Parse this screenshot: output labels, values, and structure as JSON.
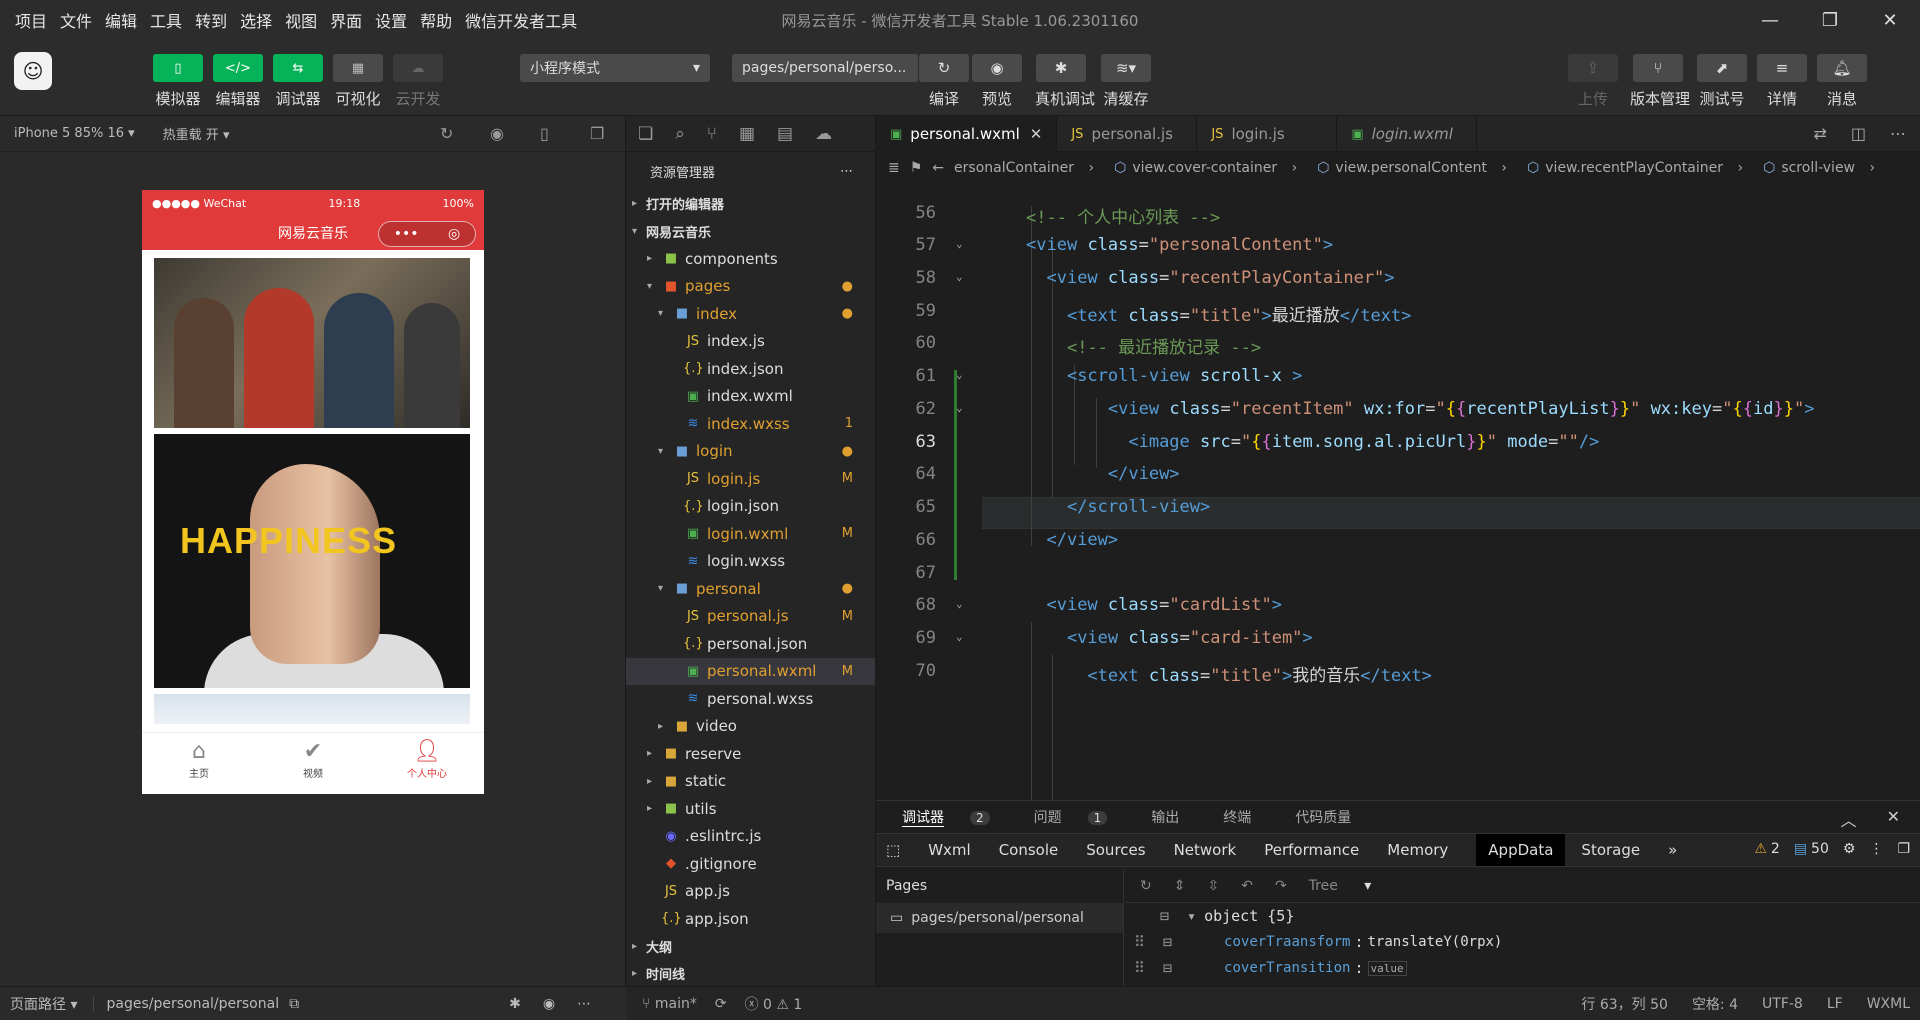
{
  "menubar": {
    "items": [
      "项目",
      "文件",
      "编辑",
      "工具",
      "转到",
      "选择",
      "视图",
      "界面",
      "设置",
      "帮助",
      "微信开发者工具"
    ],
    "title": "网易云音乐 - 微信开发者工具 Stable 1.06.2301160"
  },
  "toolbar": {
    "simulator": "模拟器",
    "editor": "编辑器",
    "debugger": "调试器",
    "visual": "可视化",
    "cloud": "云开发",
    "mode_select": "小程序模式",
    "page_select": "pages/personal/perso...",
    "compile": "编译",
    "preview": "预览",
    "real_debug": "真机调试",
    "clear_cache": "清缓存",
    "upload": "上传",
    "version": "版本管理",
    "test": "测试号",
    "details": "详情",
    "messages": "消息"
  },
  "simulator": {
    "device": "iPhone 5 85% 16",
    "hot_reload": "热重载 开",
    "phone": {
      "carrier": "●●●●● WeChat",
      "time": "19:18",
      "battery": "100%",
      "nav_title": "网易云音乐",
      "poster_text": "HAPPINESS",
      "tabs": [
        "主页",
        "视频",
        "个人中心"
      ]
    },
    "page_path_label": "页面路径",
    "page_path": "pages/personal/personal"
  },
  "explorer": {
    "title": "资源管理器",
    "open_editors": "打开的编辑器",
    "project": "网易云音乐",
    "outline": "大纲",
    "timeline": "时间线",
    "items": [
      {
        "name": "components",
        "depth": 1,
        "type": "folder",
        "status": ""
      },
      {
        "name": "pages",
        "depth": 1,
        "type": "folder-open",
        "status": "●",
        "color": "#e0a030"
      },
      {
        "name": "index",
        "depth": 2,
        "type": "folder-open",
        "status": "●",
        "color": "#e0a030"
      },
      {
        "name": "index.js",
        "depth": 3,
        "type": "js",
        "status": ""
      },
      {
        "name": "index.json",
        "depth": 3,
        "type": "json",
        "status": ""
      },
      {
        "name": "index.wxml",
        "depth": 3,
        "type": "wxml",
        "status": ""
      },
      {
        "name": "index.wxss",
        "depth": 3,
        "type": "wxss",
        "status": "1",
        "color": "#e0a030"
      },
      {
        "name": "login",
        "depth": 2,
        "type": "folder-open",
        "status": "●",
        "color": "#e0a030"
      },
      {
        "name": "login.js",
        "depth": 3,
        "type": "js",
        "status": "M",
        "color": "#e0a030"
      },
      {
        "name": "login.json",
        "depth": 3,
        "type": "json",
        "status": ""
      },
      {
        "name": "login.wxml",
        "depth": 3,
        "type": "wxml",
        "status": "M",
        "color": "#e0a030"
      },
      {
        "name": "login.wxss",
        "depth": 3,
        "type": "wxss",
        "status": ""
      },
      {
        "name": "personal",
        "depth": 2,
        "type": "folder-open",
        "status": "●",
        "color": "#e0a030"
      },
      {
        "name": "personal.js",
        "depth": 3,
        "type": "js",
        "status": "M",
        "color": "#e0a030"
      },
      {
        "name": "personal.json",
        "depth": 3,
        "type": "json",
        "status": ""
      },
      {
        "name": "personal.wxml",
        "depth": 3,
        "type": "wxml",
        "status": "M",
        "color": "#e0a030",
        "selected": true
      },
      {
        "name": "personal.wxss",
        "depth": 3,
        "type": "wxss",
        "status": ""
      },
      {
        "name": "video",
        "depth": 2,
        "type": "folder",
        "status": ""
      },
      {
        "name": "reserve",
        "depth": 1,
        "type": "folder",
        "status": ""
      },
      {
        "name": "static",
        "depth": 1,
        "type": "folder",
        "status": ""
      },
      {
        "name": "utils",
        "depth": 1,
        "type": "folder",
        "status": ""
      },
      {
        "name": ".eslintrc.js",
        "depth": 1,
        "type": "eslint",
        "status": ""
      },
      {
        "name": ".gitignore",
        "depth": 1,
        "type": "git",
        "status": ""
      },
      {
        "name": "app.js",
        "depth": 1,
        "type": "js",
        "status": ""
      },
      {
        "name": "app.json",
        "depth": 1,
        "type": "json",
        "status": ""
      }
    ]
  },
  "editor": {
    "tabs": [
      {
        "name": "personal.wxml",
        "type": "wxml",
        "active": true,
        "close": "✕"
      },
      {
        "name": "personal.js",
        "type": "js"
      },
      {
        "name": "login.js",
        "type": "js"
      },
      {
        "name": "login.wxml",
        "type": "wxml",
        "italic": true
      }
    ],
    "breadcrumbs": [
      "ersonalContainer",
      "view.cover-container",
      "view.personalContent",
      "view.recentPlayContainer",
      "scroll-view"
    ],
    "current_line": 63
  },
  "debug": {
    "tabs": [
      {
        "label": "调试器",
        "count": "2"
      },
      {
        "label": "问题",
        "count": "1"
      },
      {
        "label": "输出"
      },
      {
        "label": "终端"
      },
      {
        "label": "代码质量"
      }
    ],
    "panels": [
      "Wxml",
      "Console",
      "Sources",
      "Network",
      "Performance",
      "Memory",
      "AppData",
      "Storage"
    ],
    "active_panel": "AppData",
    "warnings": "2",
    "info": "50",
    "pages_header": "Pages",
    "page_item": "pages/personal/personal",
    "view_mode": "Tree",
    "object_label": "object {5}",
    "rows": [
      {
        "key": "coverTraansform",
        "value": "translateY(0rpx)"
      },
      {
        "key": "coverTransition",
        "value": "value"
      }
    ]
  },
  "statusbar": {
    "branch": "main*",
    "errors": "0",
    "warnings": "1",
    "position": "行 63，列 50",
    "spaces": "空格: 4",
    "encoding": "UTF-8",
    "eol": "LF",
    "language": "WXML"
  }
}
